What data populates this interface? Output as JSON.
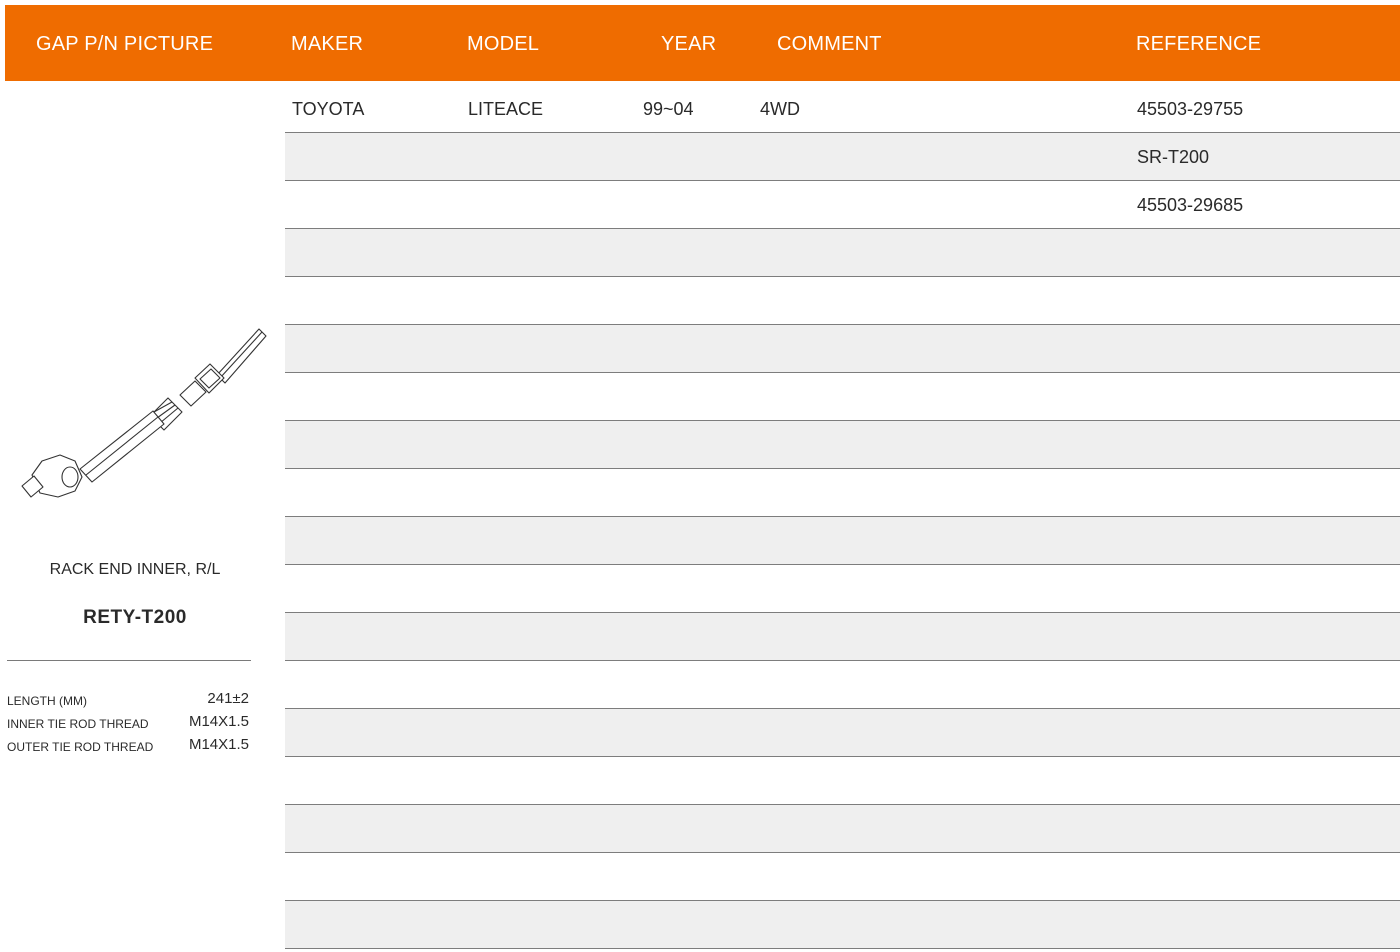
{
  "header": {
    "picture": "GAP P/N PICTURE",
    "maker": "MAKER",
    "model": "MODEL",
    "year": "YEAR",
    "comment": "COMMENT",
    "reference": "REFERENCE"
  },
  "part": {
    "description": "RACK END INNER, R/L",
    "code": "RETY-T200",
    "specs": [
      {
        "label": "LENGTH (MM)",
        "value": "241±2"
      },
      {
        "label": "INNER TIE ROD THREAD",
        "value": "M14X1.5"
      },
      {
        "label": "OUTER TIE ROD THREAD",
        "value": "M14X1.5"
      }
    ]
  },
  "rows": [
    {
      "maker": "TOYOTA",
      "model": "LITEACE",
      "year": "99~04",
      "comment": "4WD",
      "reference": "45503-29755"
    },
    {
      "maker": "",
      "model": "",
      "year": "",
      "comment": "",
      "reference": "SR-T200"
    },
    {
      "maker": "",
      "model": "",
      "year": "",
      "comment": "",
      "reference": "45503-29685"
    },
    {
      "maker": "",
      "model": "",
      "year": "",
      "comment": "",
      "reference": ""
    },
    {
      "maker": "",
      "model": "",
      "year": "",
      "comment": "",
      "reference": ""
    },
    {
      "maker": "",
      "model": "",
      "year": "",
      "comment": "",
      "reference": ""
    },
    {
      "maker": "",
      "model": "",
      "year": "",
      "comment": "",
      "reference": ""
    },
    {
      "maker": "",
      "model": "",
      "year": "",
      "comment": "",
      "reference": ""
    },
    {
      "maker": "",
      "model": "",
      "year": "",
      "comment": "",
      "reference": ""
    },
    {
      "maker": "",
      "model": "",
      "year": "",
      "comment": "",
      "reference": ""
    },
    {
      "maker": "",
      "model": "",
      "year": "",
      "comment": "",
      "reference": ""
    },
    {
      "maker": "",
      "model": "",
      "year": "",
      "comment": "",
      "reference": ""
    },
    {
      "maker": "",
      "model": "",
      "year": "",
      "comment": "",
      "reference": ""
    },
    {
      "maker": "",
      "model": "",
      "year": "",
      "comment": "",
      "reference": ""
    },
    {
      "maker": "",
      "model": "",
      "year": "",
      "comment": "",
      "reference": ""
    },
    {
      "maker": "",
      "model": "",
      "year": "",
      "comment": "",
      "reference": ""
    },
    {
      "maker": "",
      "model": "",
      "year": "",
      "comment": "",
      "reference": ""
    },
    {
      "maker": "",
      "model": "",
      "year": "",
      "comment": "",
      "reference": ""
    }
  ],
  "colors": {
    "accent": "#ef6c00",
    "row_shade": "#efefef",
    "divider": "#7d7d7d"
  },
  "icons": {
    "part_image": "tie-rod-illustration"
  }
}
